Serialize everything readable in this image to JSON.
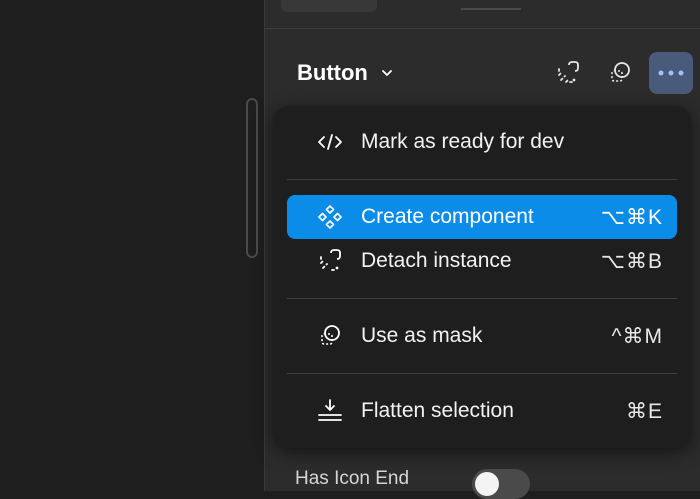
{
  "panel": {
    "component_name": "Button"
  },
  "header_icons": {
    "detach": "detach-instance-icon",
    "mask": "use-as-mask-icon",
    "more": "more-options-icon"
  },
  "menu": {
    "items": [
      {
        "label": "Mark as ready for dev",
        "shortcut": "",
        "icon": "code-icon",
        "highlighted": false
      },
      {
        "label": "Create component",
        "shortcut": "⌥⌘K",
        "icon": "component-icon",
        "highlighted": true
      },
      {
        "label": "Detach instance",
        "shortcut": "⌥⌘B",
        "icon": "detach-icon",
        "highlighted": false
      },
      {
        "label": "Use as mask",
        "shortcut": "^⌘M",
        "icon": "mask-icon",
        "highlighted": false
      },
      {
        "label": "Flatten selection",
        "shortcut": "⌘E",
        "icon": "flatten-icon",
        "highlighted": false
      }
    ]
  },
  "properties": {
    "has_icon_end_label": "Has Icon End",
    "has_icon_end_value": false
  },
  "colors": {
    "highlight": "#0c8ce9",
    "menu_bg": "#1e1e1e",
    "panel_bg": "#2c2c2c",
    "more_button_bg": "#4a5a7a"
  }
}
